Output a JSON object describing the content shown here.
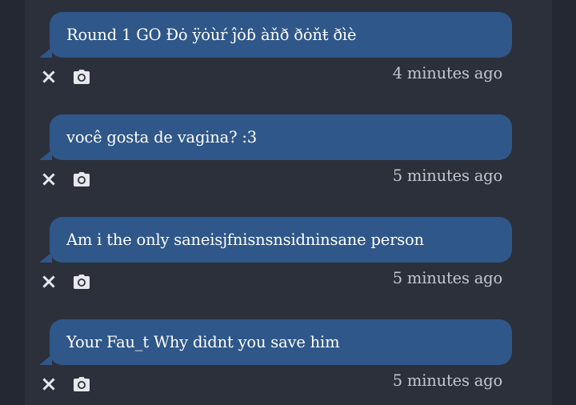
{
  "messages": [
    {
      "text": "Round 1 GO Ðȯ ÿȯùŕ ĵȯɓ àňð ðȯňŧ ðìè",
      "time": "4 minutes ago"
    },
    {
      "text": "você gosta de vagina? :3",
      "time": "5 minutes ago"
    },
    {
      "text": "Am i the only saneisjfnisnsnsidninsane person",
      "time": "5 minutes ago"
    },
    {
      "text": "Your Fau_t Why didnt you save him",
      "time": "5 minutes ago"
    }
  ],
  "icons": {
    "dismiss": "close-icon",
    "screenshot": "camera-icon"
  }
}
